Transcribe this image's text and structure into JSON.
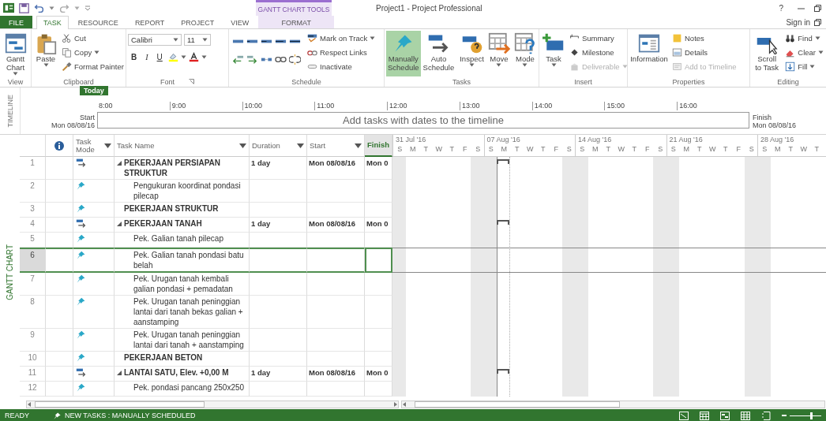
{
  "window": {
    "title": "Project1 - Project Professional",
    "context_label": "GANTT CHART TOOLS",
    "help": "?"
  },
  "tabs": [
    {
      "label": "FILE",
      "kind": "file",
      "selected": false
    },
    {
      "label": "TASK",
      "kind": "normal",
      "selected": true
    },
    {
      "label": "RESOURCE",
      "kind": "normal",
      "selected": false
    },
    {
      "label": "REPORT",
      "kind": "normal",
      "selected": false
    },
    {
      "label": "PROJECT",
      "kind": "normal",
      "selected": false
    },
    {
      "label": "VIEW",
      "kind": "normal",
      "selected": false
    },
    {
      "label": "FORMAT",
      "kind": "contextual",
      "selected": false
    }
  ],
  "account": {
    "sign_in": "Sign in"
  },
  "ribbon": [
    {
      "label": "View",
      "columns": [
        {
          "kind": "large",
          "buttons": [
            {
              "label": "Gantt Chart",
              "dropdown": true
            }
          ]
        }
      ]
    },
    {
      "label": "Clipboard",
      "columns": [
        {
          "kind": "large",
          "buttons": [
            {
              "label": "Paste",
              "dropdown": true
            }
          ]
        },
        {
          "kind": "stack",
          "buttons": [
            {
              "label": "Cut",
              "dropdown": false
            },
            {
              "label": "Copy",
              "dropdown": true
            },
            {
              "label": "Format Painter",
              "dropdown": false
            }
          ]
        }
      ]
    },
    {
      "label": "Font",
      "launcher": true,
      "columns": [
        {
          "kind": "font",
          "font": "Calibri",
          "size": "11",
          "styles": [
            "B",
            "I",
            "U"
          ]
        }
      ]
    },
    {
      "label": "Schedule",
      "columns": [
        {
          "kind": "grid"
        },
        {
          "kind": "stack",
          "buttons": [
            {
              "label": "Mark on Track",
              "dropdown": true
            },
            {
              "label": "Respect Links",
              "dropdown": false
            },
            {
              "label": "Inactivate",
              "dropdown": false
            }
          ]
        }
      ]
    },
    {
      "label": "Tasks",
      "columns": [
        {
          "kind": "large",
          "buttons": [
            {
              "label": "Manually Schedule",
              "selected": true,
              "dropdown": false
            },
            {
              "label": "Auto Schedule",
              "selected": false,
              "dropdown": false
            }
          ]
        },
        {
          "kind": "large",
          "buttons": [
            {
              "label": "Inspect",
              "dropdown": true
            },
            {
              "label": "Move",
              "dropdown": true
            },
            {
              "label": "Mode",
              "dropdown": true
            }
          ]
        }
      ]
    },
    {
      "label": "Insert",
      "columns": [
        {
          "kind": "large",
          "buttons": [
            {
              "label": "Task",
              "dropdown": true
            }
          ]
        },
        {
          "kind": "stack",
          "buttons": [
            {
              "label": "Summary",
              "disabled": false,
              "dropdown": false
            },
            {
              "label": "Milestone",
              "disabled": false,
              "dropdown": false
            },
            {
              "label": "Deliverable",
              "dropdown": true,
              "disabled": true
            }
          ]
        }
      ]
    },
    {
      "label": "Properties",
      "columns": [
        {
          "kind": "large",
          "buttons": [
            {
              "label": "Information",
              "dropdown": false
            }
          ]
        },
        {
          "kind": "stack",
          "buttons": [
            {
              "label": "Notes",
              "disabled": false,
              "dropdown": false
            },
            {
              "label": "Details",
              "disabled": false,
              "dropdown": false
            },
            {
              "label": "Add to Timeline",
              "disabled": true,
              "dropdown": false
            }
          ]
        }
      ]
    },
    {
      "label": "Editing",
      "columns": [
        {
          "kind": "large",
          "buttons": [
            {
              "label": "Scroll to Task",
              "dropdown": false
            }
          ]
        },
        {
          "kind": "stack",
          "buttons": [
            {
              "label": "Find",
              "dropdown": true
            },
            {
              "label": "Clear",
              "dropdown": true
            },
            {
              "label": "Fill",
              "dropdown": true
            }
          ]
        }
      ]
    }
  ],
  "timeline": {
    "side_label": "TIMELINE",
    "today": "Today",
    "start_label": "Start",
    "start_date": "Mon 08/08/16",
    "finish_label": "Finish",
    "finish_date": "Mon 08/08/16",
    "hours": [
      "8:00",
      "9:00",
      "10:00",
      "11:00",
      "12:00",
      "13:00",
      "14:00",
      "15:00",
      "16:00"
    ],
    "placeholder": "Add tasks with dates to the timeline"
  },
  "view_label": "GANTT CHART",
  "table": {
    "columns": [
      {
        "kind": "indicators",
        "selected": false
      },
      {
        "kind": "mode",
        "label": "Task Mode",
        "filter": true,
        "selected": false
      },
      {
        "kind": "name",
        "label": "Task Name",
        "filter": true,
        "selected": false
      },
      {
        "kind": "duration",
        "label": "Duration",
        "filter": true,
        "selected": false
      },
      {
        "kind": "start",
        "label": "Start",
        "filter": true,
        "selected": false
      },
      {
        "kind": "finish",
        "label": "Finish",
        "filter": false,
        "selected": true
      }
    ],
    "rows": [
      {
        "id": "1",
        "kind": "auto",
        "name": "PEKERJAAN PERSIAPAN STRUKTUR",
        "bold": true,
        "expanded": true,
        "duration": "1 day",
        "start": "Mon 08/08/16",
        "finish": "Mon 0",
        "selected": false,
        "children": [
          {
            "id": "2",
            "kind": "manual",
            "name": "Pengukuran koordinat pondasi pilecap",
            "bold": false,
            "selected": false
          }
        ]
      },
      {
        "id": "3",
        "kind": "manual",
        "name": "PEKERJAAN STRUKTUR",
        "bold": true,
        "selected": false
      },
      {
        "id": "4",
        "kind": "auto",
        "name": "PEKERJAAN TANAH",
        "bold": true,
        "expanded": true,
        "duration": "1 day",
        "start": "Mon 08/08/16",
        "finish": "Mon 0",
        "selected": false,
        "children": [
          {
            "id": "5",
            "kind": "manual",
            "name": "Pek. Galian tanah pilecap",
            "bold": false,
            "selected": false
          },
          {
            "id": "6",
            "kind": "manual",
            "name": "Pek. Galian tanah pondasi batu belah",
            "bold": false,
            "selected": true
          },
          {
            "id": "7",
            "kind": "manual",
            "name": "Pek. Urugan tanah kembali galian pondasi + pemadatan",
            "bold": false,
            "selected": false
          },
          {
            "id": "8",
            "kind": "manual",
            "name": "Pek. Urugan tanah peninggian lantai dari tanah bekas galian + aanstamping",
            "bold": false,
            "selected": false
          },
          {
            "id": "9",
            "kind": "manual",
            "name": "Pek. Urugan tanah peninggian lantai dari tanah + aanstamping",
            "bold": false,
            "selected": false
          }
        ]
      },
      {
        "id": "10",
        "kind": "manual",
        "name": "PEKERJAAN BETON",
        "bold": true,
        "selected": false
      },
      {
        "id": "11",
        "kind": "auto",
        "name": "LANTAI SATU, Elev. +0,00 M",
        "bold": true,
        "expanded": true,
        "duration": "1 day",
        "start": "Mon 08/08/16",
        "finish": "Mon 0",
        "selected": false,
        "children": [
          {
            "id": "12",
            "kind": "manual",
            "name": "Pek. pondasi pancang 250x250",
            "bold": false,
            "selected": false
          }
        ]
      }
    ]
  },
  "gantt": {
    "weeks": [
      {
        "label": "31 Jul '16",
        "days": [
          {
            "label": "S",
            "weekend": true,
            "today": false
          },
          {
            "label": "M",
            "weekend": false,
            "today": false
          },
          {
            "label": "T",
            "weekend": false,
            "today": false
          },
          {
            "label": "W",
            "weekend": false,
            "today": false
          },
          {
            "label": "T",
            "weekend": false,
            "today": false
          },
          {
            "label": "F",
            "weekend": false,
            "today": false
          },
          {
            "label": "S",
            "weekend": true,
            "today": false
          }
        ]
      },
      {
        "label": "07 Aug '16",
        "days": [
          {
            "label": "S",
            "weekend": true,
            "today": false
          },
          {
            "label": "M",
            "weekend": false,
            "today": true
          },
          {
            "label": "T",
            "weekend": false,
            "today": false
          },
          {
            "label": "W",
            "weekend": false,
            "today": false
          },
          {
            "label": "T",
            "weekend": false,
            "today": false
          },
          {
            "label": "F",
            "weekend": false,
            "today": false
          },
          {
            "label": "S",
            "weekend": true,
            "today": false
          }
        ]
      },
      {
        "label": "14 Aug '16",
        "days": [
          {
            "label": "S",
            "weekend": true,
            "today": false
          },
          {
            "label": "M",
            "weekend": false,
            "today": false
          },
          {
            "label": "T",
            "weekend": false,
            "today": false
          },
          {
            "label": "W",
            "weekend": false,
            "today": false
          },
          {
            "label": "T",
            "weekend": false,
            "today": false
          },
          {
            "label": "F",
            "weekend": false,
            "today": false
          },
          {
            "label": "S",
            "weekend": true,
            "today": false
          }
        ]
      },
      {
        "label": "21 Aug '16",
        "days": [
          {
            "label": "S",
            "weekend": true,
            "today": false
          },
          {
            "label": "M",
            "weekend": false,
            "today": false
          },
          {
            "label": "T",
            "weekend": false,
            "today": false
          },
          {
            "label": "W",
            "weekend": false,
            "today": false
          },
          {
            "label": "T",
            "weekend": false,
            "today": false
          },
          {
            "label": "F",
            "weekend": false,
            "today": false
          },
          {
            "label": "S",
            "weekend": true,
            "today": false
          }
        ]
      },
      {
        "label": "28 Aug '16",
        "days": [
          {
            "label": "S",
            "weekend": true,
            "today": false
          },
          {
            "label": "M",
            "weekend": false,
            "today": false
          },
          {
            "label": "T",
            "weekend": false,
            "today": false
          },
          {
            "label": "W",
            "weekend": false,
            "today": false
          },
          {
            "label": "T",
            "weekend": false,
            "today": false
          }
        ]
      }
    ]
  },
  "status_bar": {
    "mode": "READY",
    "new_tasks": "NEW TASKS : MANUALLY SCHEDULED",
    "zoom": {
      "level": 0.7
    }
  }
}
